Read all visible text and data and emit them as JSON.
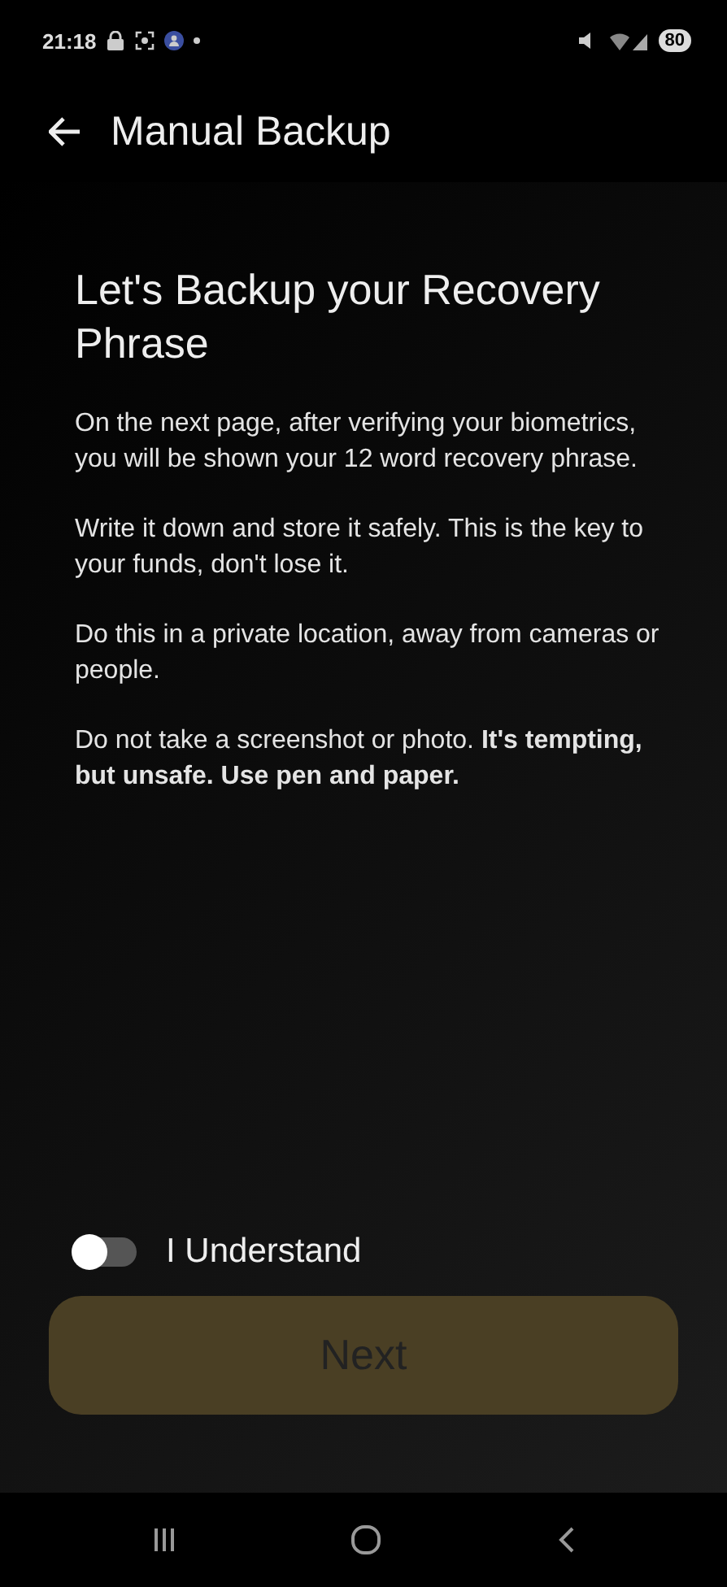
{
  "status_bar": {
    "time": "21:18",
    "battery": "80"
  },
  "header": {
    "title": "Manual Backup"
  },
  "heading": "Let's Backup your Recovery Phrase",
  "paragraphs": [
    "On the next page, after verifying your biometrics, you will be shown your 12 word recovery phrase.",
    "Write it down and store it safely. This is the key to your funds, don't lose it.",
    "Do this in a private location, away from cameras or people.",
    "Do not take a screenshot or photo. **It's tempting, but unsafe. Use pen and paper.**"
  ],
  "consent": {
    "label": "I Understand",
    "on": false
  },
  "next_button": {
    "label": "Next",
    "disabled": true
  }
}
